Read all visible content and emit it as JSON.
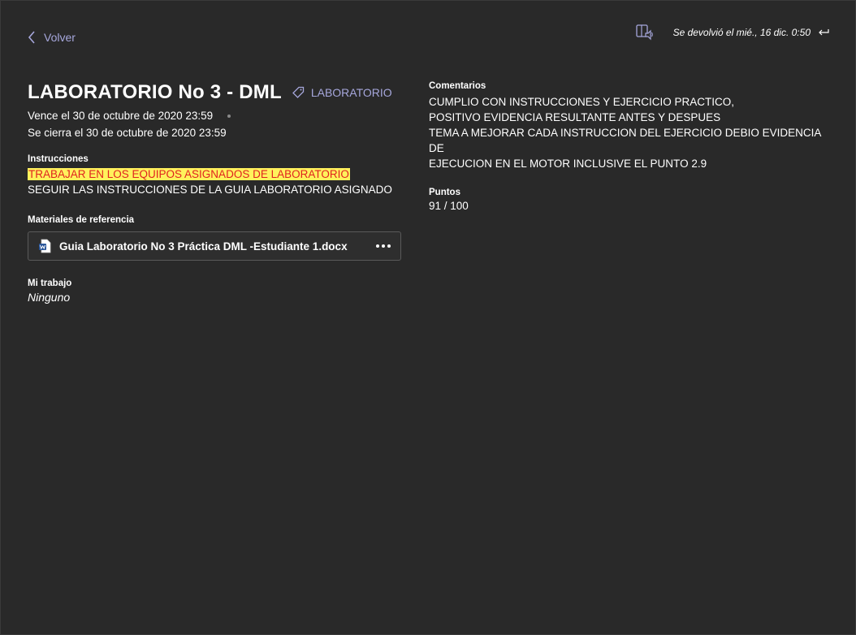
{
  "nav": {
    "back_label": "Volver"
  },
  "header": {
    "returned_text": "Se devolvió el mié., 16 dic. 0:50",
    "reader_icon": "immersive-reader-icon",
    "returned_icon": "return-arrow-icon"
  },
  "assignment": {
    "title": "LABORATORIO No 3 - DML",
    "category": "LABORATORIO",
    "due": "Vence el 30 de octubre de 2020 23:59",
    "closes": "Se cierra el 30 de octubre de 2020 23:59"
  },
  "instructions": {
    "label": "Instrucciones",
    "highlighted_line": "TRABAJAR EN LOS EQUIPOS ASIGNADOS DE LABORATORIO",
    "line2": "SEGUIR LAS INSTRUCCIONES DE LA GUIA LABORATORIO ASIGNADO",
    "highlight_bg": "#fff15c",
    "highlight_fg": "#e0231f"
  },
  "materials": {
    "label": "Materiales de referencia",
    "file_name": "Guia Laboratorio No 3 Práctica DML -Estudiante 1.docx",
    "file_icon": "word-doc-icon"
  },
  "my_work": {
    "label": "Mi trabajo",
    "value": "Ninguno"
  },
  "feedback": {
    "comments_label": "Comentarios",
    "comments_lines": [
      "CUMPLIO CON INSTRUCCIONES Y EJERCICIO PRACTICO,",
      "POSITIVO EVIDENCIA RESULTANTE ANTES Y DESPUES",
      "TEMA A MEJORAR CADA INSTRUCCION DEL EJERCICIO DEBIO EVIDENCIA DE",
      "EJECUCION EN EL MOTOR  INCLUSIVE EL PUNTO 2.9"
    ],
    "points_label": "Puntos",
    "points_value": "91 / 100"
  },
  "colors": {
    "background": "#292929",
    "accent": "#a6a7dc",
    "text": "#ffffff"
  }
}
